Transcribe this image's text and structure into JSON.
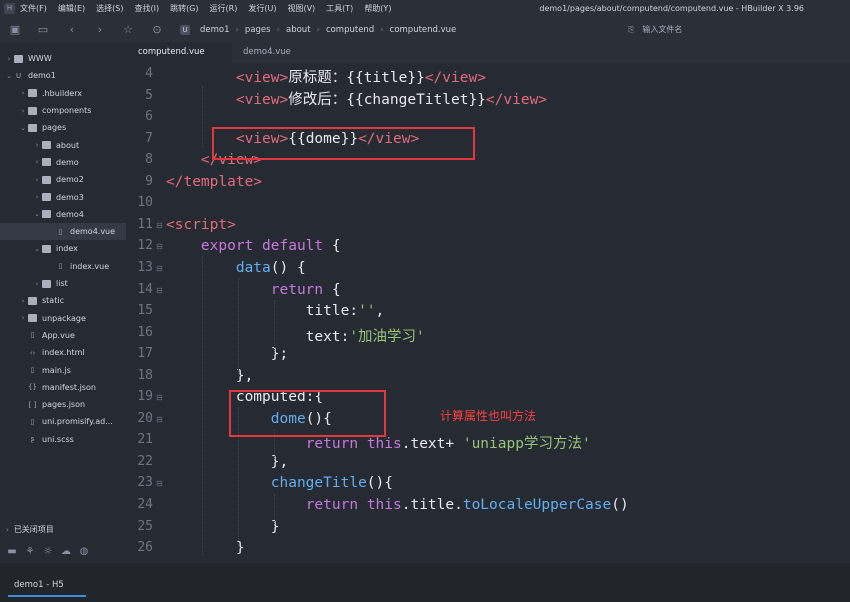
{
  "titlebar": {
    "logo": "H",
    "menu": [
      "文件(F)",
      "编辑(E)",
      "选择(S)",
      "查找(I)",
      "跳转(G)",
      "运行(R)",
      "发行(U)",
      "视图(V)",
      "工具(T)",
      "帮助(Y)"
    ],
    "window_title": "demo1/pages/about/computend/computend.vue - HBuilder X 3.96"
  },
  "toolbar": {
    "icons": [
      "new-file-icon",
      "save-icon",
      "back-icon",
      "forward-icon",
      "star-icon",
      "run-icon"
    ],
    "breadcrumb": [
      "demo1",
      "pages",
      "about",
      "computend",
      "computend.vue"
    ],
    "file_input_placeholder": "输入文件名"
  },
  "sidebar": {
    "tree": [
      {
        "label": "WWW",
        "type": "folder",
        "arrow": "›",
        "depth": 0
      },
      {
        "label": "demo1",
        "type": "project",
        "arrow": "⌄",
        "depth": 0
      },
      {
        "label": ".hbuilderx",
        "type": "folder",
        "arrow": "›",
        "depth": 1
      },
      {
        "label": "components",
        "type": "folder",
        "arrow": "›",
        "depth": 1
      },
      {
        "label": "pages",
        "type": "folder",
        "arrow": "⌄",
        "depth": 1
      },
      {
        "label": "about",
        "type": "folder",
        "arrow": "›",
        "depth": 2
      },
      {
        "label": "demo",
        "type": "folder",
        "arrow": "›",
        "depth": 2
      },
      {
        "label": "demo2",
        "type": "folder",
        "arrow": "›",
        "depth": 2
      },
      {
        "label": "demo3",
        "type": "folder",
        "arrow": "›",
        "depth": 2
      },
      {
        "label": "demo4",
        "type": "folder",
        "arrow": "⌄",
        "depth": 2
      },
      {
        "label": "demo4.vue",
        "type": "file",
        "arrow": "",
        "depth": 3,
        "selected": true
      },
      {
        "label": "index",
        "type": "folder",
        "arrow": "⌄",
        "depth": 2
      },
      {
        "label": "index.vue",
        "type": "file",
        "arrow": "",
        "depth": 3
      },
      {
        "label": "list",
        "type": "folder",
        "arrow": "›",
        "depth": 2
      },
      {
        "label": "static",
        "type": "folder",
        "arrow": "›",
        "depth": 1
      },
      {
        "label": "unpackage",
        "type": "folder",
        "arrow": "›",
        "depth": 1
      },
      {
        "label": "App.vue",
        "type": "file",
        "arrow": "",
        "depth": 1
      },
      {
        "label": "index.html",
        "type": "code",
        "arrow": "",
        "depth": 1
      },
      {
        "label": "main.js",
        "type": "file",
        "arrow": "",
        "depth": 1
      },
      {
        "label": "manifest.json",
        "type": "json",
        "arrow": "",
        "depth": 1
      },
      {
        "label": "pages.json",
        "type": "bracket",
        "arrow": "",
        "depth": 1
      },
      {
        "label": "uni.promisify.ad...",
        "type": "file",
        "arrow": "",
        "depth": 1
      },
      {
        "label": "uni.scss",
        "type": "sass",
        "arrow": "",
        "depth": 1
      }
    ],
    "closed_projects": "已关闭项目",
    "bottom_icons": [
      "folder-icon",
      "plugin-icon",
      "debug-icon",
      "cloud-icon",
      "globe-icon"
    ]
  },
  "tabs": [
    {
      "label": "computend.vue",
      "active": true
    },
    {
      "label": "demo4.vue",
      "active": false
    }
  ],
  "editor": {
    "lines": [
      {
        "n": "4",
        "fold": ""
      },
      {
        "n": "5",
        "fold": ""
      },
      {
        "n": "6",
        "fold": ""
      },
      {
        "n": "7",
        "fold": ""
      },
      {
        "n": "8",
        "fold": ""
      },
      {
        "n": "9",
        "fold": ""
      },
      {
        "n": "10",
        "fold": ""
      },
      {
        "n": "11",
        "fold": "⊟"
      },
      {
        "n": "12",
        "fold": "⊟"
      },
      {
        "n": "13",
        "fold": "⊟"
      },
      {
        "n": "14",
        "fold": "⊟"
      },
      {
        "n": "15",
        "fold": ""
      },
      {
        "n": "16",
        "fold": ""
      },
      {
        "n": "17",
        "fold": ""
      },
      {
        "n": "18",
        "fold": ""
      },
      {
        "n": "19",
        "fold": "⊟"
      },
      {
        "n": "20",
        "fold": "⊟"
      },
      {
        "n": "21",
        "fold": ""
      },
      {
        "n": "22",
        "fold": ""
      },
      {
        "n": "23",
        "fold": "⊟"
      },
      {
        "n": "24",
        "fold": ""
      },
      {
        "n": "25",
        "fold": ""
      },
      {
        "n": "26",
        "fold": ""
      }
    ],
    "code": [
      [
        {
          "t": "        ",
          "c": "plain"
        },
        {
          "t": "<view>",
          "c": "tag"
        },
        {
          "t": "原标题：{{title}}",
          "c": "plain"
        },
        {
          "t": "</view>",
          "c": "tag"
        }
      ],
      [
        {
          "t": "        ",
          "c": "plain"
        },
        {
          "t": "<view>",
          "c": "tag"
        },
        {
          "t": "修改后：{{changeTitlet}}",
          "c": "plain"
        },
        {
          "t": "</view>",
          "c": "tag"
        }
      ],
      [],
      [
        {
          "t": "        ",
          "c": "plain"
        },
        {
          "t": "<view>",
          "c": "tag"
        },
        {
          "t": "{{dome}}",
          "c": "plain"
        },
        {
          "t": "</view>",
          "c": "tag"
        }
      ],
      [
        {
          "t": "    ",
          "c": "plain"
        },
        {
          "t": "</view>",
          "c": "tag"
        }
      ],
      [
        {
          "t": "</template>",
          "c": "tag"
        }
      ],
      [],
      [
        {
          "t": "<script>",
          "c": "tag"
        }
      ],
      [
        {
          "t": "    ",
          "c": "plain"
        },
        {
          "t": "export default",
          "c": "kw"
        },
        {
          "t": " {",
          "c": "plain"
        }
      ],
      [
        {
          "t": "        ",
          "c": "plain"
        },
        {
          "t": "data",
          "c": "fn"
        },
        {
          "t": "() {",
          "c": "plain"
        }
      ],
      [
        {
          "t": "            ",
          "c": "plain"
        },
        {
          "t": "return",
          "c": "kw"
        },
        {
          "t": " {",
          "c": "plain"
        }
      ],
      [
        {
          "t": "                title:",
          "c": "plain"
        },
        {
          "t": "''",
          "c": "str"
        },
        {
          "t": ",",
          "c": "plain"
        }
      ],
      [
        {
          "t": "                text:",
          "c": "plain"
        },
        {
          "t": "'加油学习'",
          "c": "str"
        }
      ],
      [
        {
          "t": "            };",
          "c": "plain"
        }
      ],
      [
        {
          "t": "        },",
          "c": "plain"
        }
      ],
      [
        {
          "t": "        computed:{",
          "c": "plain"
        }
      ],
      [
        {
          "t": "            ",
          "c": "plain"
        },
        {
          "t": "dome",
          "c": "fn"
        },
        {
          "t": "(){",
          "c": "plain"
        }
      ],
      [
        {
          "t": "                ",
          "c": "plain"
        },
        {
          "t": "return",
          "c": "kw"
        },
        {
          "t": " ",
          "c": "plain"
        },
        {
          "t": "this",
          "c": "kw"
        },
        {
          "t": ".text+ ",
          "c": "plain"
        },
        {
          "t": "'uniapp学习方法'",
          "c": "str"
        }
      ],
      [
        {
          "t": "            },",
          "c": "plain"
        }
      ],
      [
        {
          "t": "            ",
          "c": "plain"
        },
        {
          "t": "changeTitle",
          "c": "fn"
        },
        {
          "t": "(){",
          "c": "plain"
        }
      ],
      [
        {
          "t": "                ",
          "c": "plain"
        },
        {
          "t": "return",
          "c": "kw"
        },
        {
          "t": " ",
          "c": "plain"
        },
        {
          "t": "this",
          "c": "kw"
        },
        {
          "t": ".title.",
          "c": "plain"
        },
        {
          "t": "toLocaleUpperCase",
          "c": "fn"
        },
        {
          "t": "()",
          "c": "plain"
        }
      ],
      [
        {
          "t": "            }",
          "c": "plain"
        }
      ],
      [
        {
          "t": "        }",
          "c": "plain"
        }
      ]
    ],
    "annotation": "计算属性也叫方法"
  },
  "statusbar": {
    "tab": "demo1 - H5"
  },
  "colors": {
    "tag": "#e26b7a",
    "keyword": "#c678dd",
    "function": "#61afef",
    "string": "#98c379",
    "annotation": "#ff4040",
    "highlight_box": "#e0383c"
  }
}
